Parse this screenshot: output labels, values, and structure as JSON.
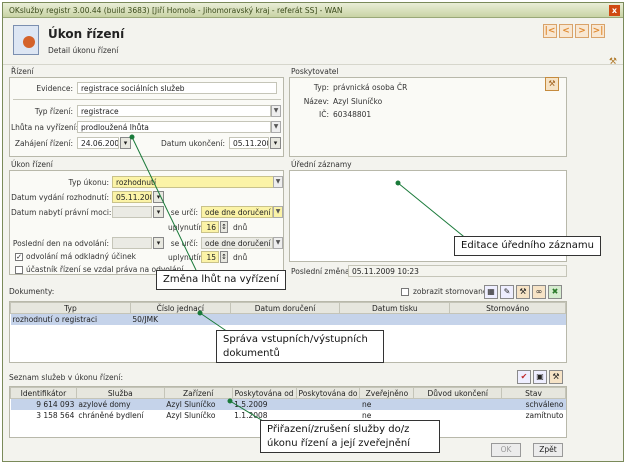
{
  "window": {
    "title": "OKslužby registr 3.00.44 (build 3683) [Jiří Homola - Jihomoravský kraj - referát SS] - WAN",
    "close": "x"
  },
  "header": {
    "title": "Úkon řízení",
    "subtitle": "Detail úkonu řízení"
  },
  "nav": {
    "first": "|<",
    "prev": "<",
    "next": ">",
    "last": ">|"
  },
  "rizeni": {
    "title": "Řízení",
    "evidence_label": "Evidence:",
    "evidence": "registrace sociálních služeb",
    "typ_label": "Typ řízení:",
    "typ": "registrace",
    "lhuta_label": "Lhůta na vyřízení:",
    "lhuta": "prodloužená lhůta",
    "zahajeni_label": "Zahájení řízení:",
    "zahajeni": "24.06.2009",
    "ukonceni_label": "Datum ukončení:",
    "ukonceni": "05.11.2009"
  },
  "poskytovatel": {
    "title": "Poskytovatel",
    "typ_label": "Typ:",
    "typ": "právnická osoba ČR",
    "nazev_label": "Název:",
    "nazev": "Azyl Sluníčko",
    "ic_label": "IČ:",
    "ic": "60348801"
  },
  "ukon": {
    "title": "Úkon řízení",
    "typ_label": "Typ úkonu:",
    "typ": "rozhodnutí",
    "vydani_label": "Datum vydání rozhodnutí:",
    "vydani": "05.11.2009",
    "nabyti_label": "Datum nabytí právní moci:",
    "nabyti": "",
    "se_urci1": "se určí:",
    "urci1": "ode dne doručení",
    "uplynutim1": "uplynutím:",
    "uplynutim1_val": "16",
    "dnu1": "dnů",
    "odvolani_label": "Poslední den na odvolání:",
    "se_urci2": "se určí:",
    "urci2": "ode dne doručení",
    "uplynutim2": "uplynutím:",
    "uplynutim2_val": "15",
    "dnu2": "dnů",
    "cb1": "odvolání má odkladný účinek",
    "cb2": "účastník řízení se vzdal práva na odvolání"
  },
  "zaznamy": {
    "title": "Úřední záznamy",
    "zmena_label": "Poslední změna:",
    "zmena": "05.11.2009 10:23"
  },
  "dokumenty": {
    "title": "Dokumenty:",
    "stornovane": "zobrazit stornované",
    "columns": [
      "Typ",
      "Číslo jednací",
      "Datum doručení",
      "Datum tisku",
      "Stornováno"
    ],
    "rows": [
      [
        "rozhodnutí o registraci",
        "50/JMK",
        "",
        "",
        ""
      ]
    ]
  },
  "sluzby": {
    "title": "Seznam služeb v úkonu řízení:",
    "columns": [
      "Identifikátor",
      "Služba",
      "Zařízení",
      "Poskytována od",
      "Poskytována do",
      "Zveřejněno",
      "Důvod ukončení",
      "Stav"
    ],
    "rows": [
      [
        "9 614 093",
        "azylové domy",
        "Azyl Sluníčko",
        "1.5.2009",
        "",
        "ne",
        "",
        "schváleno"
      ],
      [
        "3 158 564",
        "chráněné bydlení",
        "Azyl Sluníčko",
        "1.1.2008",
        "",
        "ne",
        "",
        "zamítnuto"
      ]
    ]
  },
  "buttons": {
    "ok": "OK",
    "zpet": "Zpět"
  },
  "callouts": {
    "c1": "Editace úředního záznamu",
    "c2": "Změna lhůt na vyřízení",
    "c3": "Správa vstupních/výstupních dokumentů",
    "c4": "Přiřazení/zrušení služby do/z úkonu řízení a její zveřejnění"
  }
}
